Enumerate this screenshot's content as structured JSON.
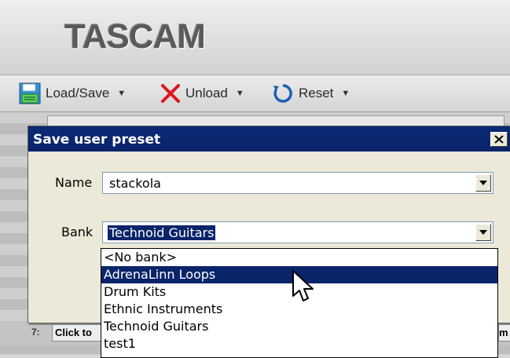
{
  "brand": {
    "logo": "TASCAM"
  },
  "toolbar": {
    "load_save": "Load/Save",
    "unload": "Unload",
    "reset": "Reset"
  },
  "dialog": {
    "title": "Save user preset",
    "name_label": "Name",
    "name_value": "stackola",
    "bank_label": "Bank",
    "bank_value": "Technoid Guitars",
    "bank_options": [
      "<No bank>",
      "AdrenaLinn Loops",
      "Drum Kits",
      "Ethnic Instruments",
      "Technoid Guitars",
      "test1"
    ],
    "highlighted_option": "AdrenaLinn Loops"
  },
  "background": {
    "row_number": "7:",
    "row_button": "Click to",
    "row_right": "m"
  },
  "colors": {
    "title_bar": "#0a246a",
    "dialog_bg": "#ece9d8",
    "highlight": "#0a246a",
    "unload_icon": "#e0141e",
    "reset_icon": "#1e5fb4"
  }
}
